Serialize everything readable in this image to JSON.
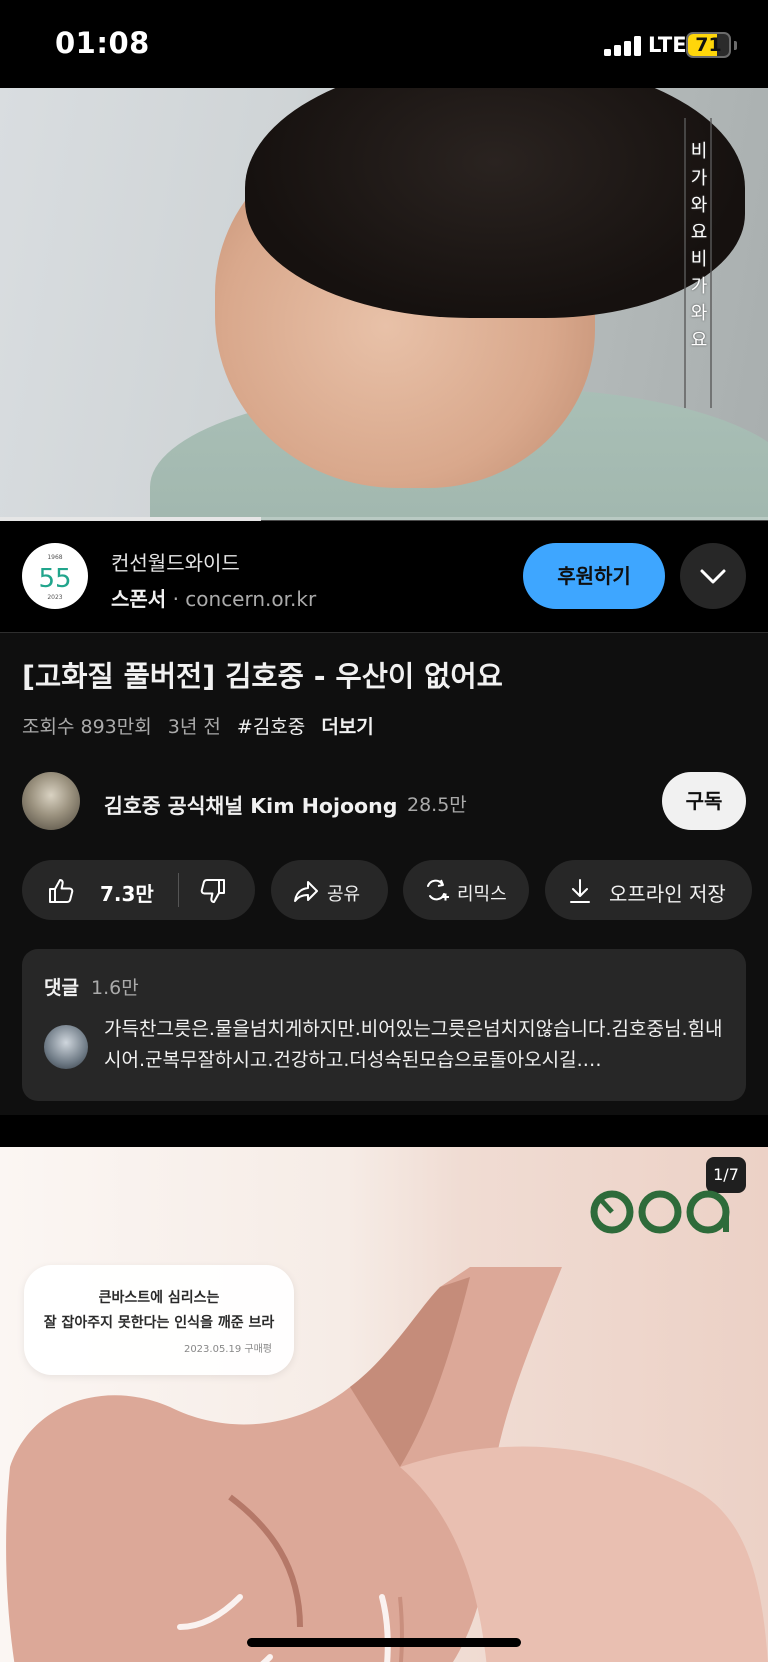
{
  "status_bar": {
    "time": "01:08",
    "network": "LTE",
    "battery_level": "71",
    "battery_fraction": 0.71
  },
  "video": {
    "overlay_caption": "비가와요 비가와요",
    "progress_fraction": 0.34
  },
  "sponsor": {
    "name": "컨선월드와이드",
    "label": "스폰서",
    "separator": "·",
    "url": "concern.or.kr",
    "logo_text": "55",
    "logo_years_top": "1968",
    "logo_years_bottom": "2023",
    "cta_label": "후원하기",
    "accent_color": "#3ea6ff"
  },
  "video_info": {
    "title": "[고화질 풀버전] 김호중 - 우산이 없어요",
    "views": "조회수 893만회",
    "age": "3년 전",
    "hashtag": "#김호중",
    "more_label": "더보기"
  },
  "channel": {
    "name": "김호중 공식채널 Kim Hojoong",
    "subscribers": "28.5만",
    "subscribe_label": "구독"
  },
  "actions": {
    "like_count": "7.3만",
    "share_label": "공유",
    "remix_label": "리믹스",
    "download_label": "오프라인 저장",
    "icons": [
      "thumbs-up-icon",
      "thumbs-down-icon",
      "share-icon",
      "remix-icon",
      "download-icon"
    ]
  },
  "comments": {
    "label": "댓글",
    "count": "1.6만",
    "top_comment": "가득찬그릇은.물을넘치게하지만.비어있는그릇은넘치지않습니다.김호중님.힘내시어.군복무잘하시고.건강하고.더성숙된모습으로돌아오시길.…"
  },
  "ad": {
    "counter": "1/7",
    "brand": "ooa",
    "bubble_line1": "큰바스트에 심리스는",
    "bubble_line2": "잘 잡아주지 못한다는 인식을 깨준 브라",
    "review_meta": "2023.05.19 구매평",
    "brand_color": "#2e6b3a"
  }
}
